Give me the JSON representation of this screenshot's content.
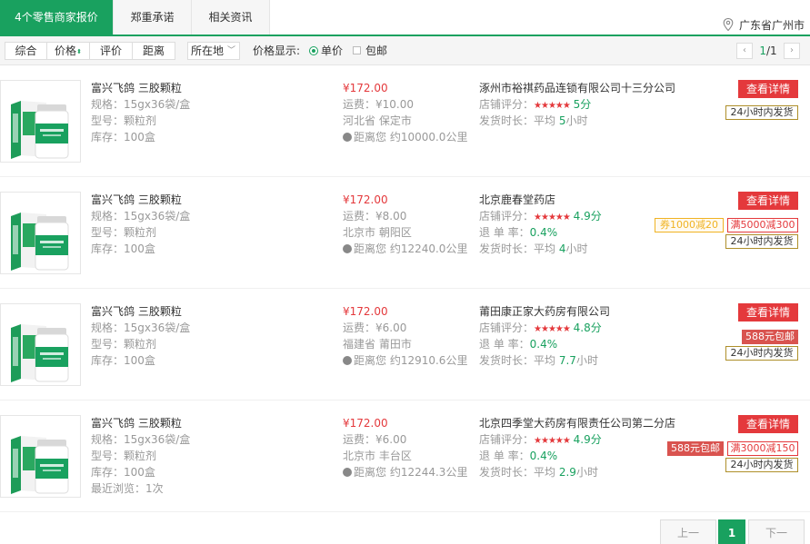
{
  "tabs": [
    {
      "label": "4个零售商家报价",
      "active": true
    },
    {
      "label": "郑重承诺",
      "active": false
    },
    {
      "label": "相关资讯",
      "active": false
    }
  ],
  "location": {
    "text": "广东省广州市",
    "icon": "map-pin-icon"
  },
  "filter": {
    "sort_buttons": [
      "综合",
      "价格",
      "评价",
      "距离"
    ],
    "region_select": "所在地",
    "price_display_label": "价格显示:",
    "option_unit": "单价",
    "option_shipping": "包邮",
    "selected_option": "单价",
    "page_indicator_current": "1",
    "page_indicator_sep": "/",
    "page_indicator_total": "1"
  },
  "items": [
    {
      "name": "富兴飞鸽 三胶颗粒",
      "spec": "规格：15gx36袋/盒",
      "type": "型号：颗粒剂",
      "stock": "库存：100盒",
      "recent": "",
      "price": "¥172.00",
      "freight": "运费：¥10.00",
      "origin": "河北省 保定市",
      "distance": "距离您 约10000.0公里",
      "store": "涿州市裕祺药品连锁有限公司十三分公司",
      "rating_label": "店铺评分：",
      "stars": "★★★★★",
      "rating": "5分",
      "return_label": "",
      "return_rate": "",
      "ship_label": "发货时长：",
      "ship_pre": "平均",
      "ship_value": "5",
      "ship_unit": "小时",
      "detail_button": "查看详情",
      "promo_tags": [],
      "ship_tag": "24小时内发货"
    },
    {
      "name": "富兴飞鸽 三胶颗粒",
      "spec": "规格：15gx36袋/盒",
      "type": "型号：颗粒剂",
      "stock": "库存：100盒",
      "recent": "",
      "price": "¥172.00",
      "freight": "运费：¥8.00",
      "origin": "北京市 朝阳区",
      "distance": "距离您 约12240.0公里",
      "store": "北京鹿春堂药店",
      "rating_label": "店铺评分：",
      "stars": "★★★★★",
      "rating": "4.9分",
      "return_label": "退 单 率：",
      "return_rate": "0.4%",
      "ship_label": "发货时长：",
      "ship_pre": "平均",
      "ship_value": "4",
      "ship_unit": "小时",
      "detail_button": "查看详情",
      "promo_tags": [
        {
          "text": "券1000减20",
          "kind": "coupon"
        },
        {
          "text": "满5000减300",
          "kind": "full"
        }
      ],
      "ship_tag": "24小时内发货"
    },
    {
      "name": "富兴飞鸽 三胶颗粒",
      "spec": "规格：15gx36袋/盒",
      "type": "型号：颗粒剂",
      "stock": "库存：100盒",
      "recent": "",
      "price": "¥172.00",
      "freight": "运费：¥6.00",
      "origin": "福建省 莆田市",
      "distance": "距离您 约12910.6公里",
      "store": "莆田康正家大药房有限公司",
      "rating_label": "店铺评分：",
      "stars": "★★★★★",
      "rating": "4.8分",
      "return_label": "退 单 率：",
      "return_rate": "0.4%",
      "ship_label": "发货时长：",
      "ship_pre": "平均",
      "ship_value": "7.7",
      "ship_unit": "小时",
      "detail_button": "查看详情",
      "promo_tags": [
        {
          "text": "588元包邮",
          "kind": "free"
        }
      ],
      "ship_tag": "24小时内发货"
    },
    {
      "name": "富兴飞鸽 三胶颗粒",
      "spec": "规格：15gx36袋/盒",
      "type": "型号：颗粒剂",
      "stock": "库存：100盒",
      "recent": "最近浏览：1次",
      "price": "¥172.00",
      "freight": "运费：¥6.00",
      "origin": "北京市 丰台区",
      "distance": "距离您 约12244.3公里",
      "store": "北京四季堂大药房有限责任公司第二分店",
      "rating_label": "店铺评分：",
      "stars": "★★★★★",
      "rating": "4.9分",
      "return_label": "退 单 率：",
      "return_rate": "0.4%",
      "ship_label": "发货时长：",
      "ship_pre": "平均",
      "ship_value": "2.9",
      "ship_unit": "小时",
      "detail_button": "查看详情",
      "promo_tags": [
        {
          "text": "588元包邮",
          "kind": "free"
        },
        {
          "text": "满3000减150",
          "kind": "full"
        }
      ],
      "ship_tag": "24小时内发货"
    }
  ],
  "pager": {
    "prev": "上一",
    "current": "1",
    "next": "下一"
  },
  "colors": {
    "brand_green": "#19a15f",
    "price_red": "#e4393c",
    "star_red": "#e4393c"
  }
}
